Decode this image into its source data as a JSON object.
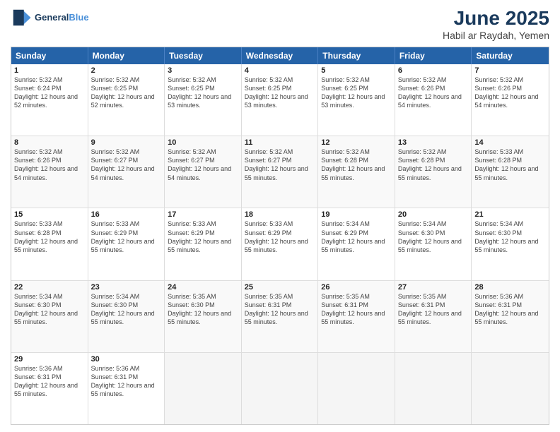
{
  "header": {
    "logo_line1": "General",
    "logo_line2": "Blue",
    "title": "June 2025",
    "subtitle": "Habil ar Raydah, Yemen"
  },
  "weekdays": [
    "Sunday",
    "Monday",
    "Tuesday",
    "Wednesday",
    "Thursday",
    "Friday",
    "Saturday"
  ],
  "weeks": [
    [
      {
        "day": "1",
        "sunrise": "5:32 AM",
        "sunset": "6:24 PM",
        "daylight": "12 hours and 52 minutes."
      },
      {
        "day": "2",
        "sunrise": "5:32 AM",
        "sunset": "6:25 PM",
        "daylight": "12 hours and 52 minutes."
      },
      {
        "day": "3",
        "sunrise": "5:32 AM",
        "sunset": "6:25 PM",
        "daylight": "12 hours and 53 minutes."
      },
      {
        "day": "4",
        "sunrise": "5:32 AM",
        "sunset": "6:25 PM",
        "daylight": "12 hours and 53 minutes."
      },
      {
        "day": "5",
        "sunrise": "5:32 AM",
        "sunset": "6:25 PM",
        "daylight": "12 hours and 53 minutes."
      },
      {
        "day": "6",
        "sunrise": "5:32 AM",
        "sunset": "6:26 PM",
        "daylight": "12 hours and 54 minutes."
      },
      {
        "day": "7",
        "sunrise": "5:32 AM",
        "sunset": "6:26 PM",
        "daylight": "12 hours and 54 minutes."
      }
    ],
    [
      {
        "day": "8",
        "sunrise": "5:32 AM",
        "sunset": "6:26 PM",
        "daylight": "12 hours and 54 minutes."
      },
      {
        "day": "9",
        "sunrise": "5:32 AM",
        "sunset": "6:27 PM",
        "daylight": "12 hours and 54 minutes."
      },
      {
        "day": "10",
        "sunrise": "5:32 AM",
        "sunset": "6:27 PM",
        "daylight": "12 hours and 54 minutes."
      },
      {
        "day": "11",
        "sunrise": "5:32 AM",
        "sunset": "6:27 PM",
        "daylight": "12 hours and 55 minutes."
      },
      {
        "day": "12",
        "sunrise": "5:32 AM",
        "sunset": "6:28 PM",
        "daylight": "12 hours and 55 minutes."
      },
      {
        "day": "13",
        "sunrise": "5:32 AM",
        "sunset": "6:28 PM",
        "daylight": "12 hours and 55 minutes."
      },
      {
        "day": "14",
        "sunrise": "5:33 AM",
        "sunset": "6:28 PM",
        "daylight": "12 hours and 55 minutes."
      }
    ],
    [
      {
        "day": "15",
        "sunrise": "5:33 AM",
        "sunset": "6:28 PM",
        "daylight": "12 hours and 55 minutes."
      },
      {
        "day": "16",
        "sunrise": "5:33 AM",
        "sunset": "6:29 PM",
        "daylight": "12 hours and 55 minutes."
      },
      {
        "day": "17",
        "sunrise": "5:33 AM",
        "sunset": "6:29 PM",
        "daylight": "12 hours and 55 minutes."
      },
      {
        "day": "18",
        "sunrise": "5:33 AM",
        "sunset": "6:29 PM",
        "daylight": "12 hours and 55 minutes."
      },
      {
        "day": "19",
        "sunrise": "5:34 AM",
        "sunset": "6:29 PM",
        "daylight": "12 hours and 55 minutes."
      },
      {
        "day": "20",
        "sunrise": "5:34 AM",
        "sunset": "6:30 PM",
        "daylight": "12 hours and 55 minutes."
      },
      {
        "day": "21",
        "sunrise": "5:34 AM",
        "sunset": "6:30 PM",
        "daylight": "12 hours and 55 minutes."
      }
    ],
    [
      {
        "day": "22",
        "sunrise": "5:34 AM",
        "sunset": "6:30 PM",
        "daylight": "12 hours and 55 minutes."
      },
      {
        "day": "23",
        "sunrise": "5:34 AM",
        "sunset": "6:30 PM",
        "daylight": "12 hours and 55 minutes."
      },
      {
        "day": "24",
        "sunrise": "5:35 AM",
        "sunset": "6:30 PM",
        "daylight": "12 hours and 55 minutes."
      },
      {
        "day": "25",
        "sunrise": "5:35 AM",
        "sunset": "6:31 PM",
        "daylight": "12 hours and 55 minutes."
      },
      {
        "day": "26",
        "sunrise": "5:35 AM",
        "sunset": "6:31 PM",
        "daylight": "12 hours and 55 minutes."
      },
      {
        "day": "27",
        "sunrise": "5:35 AM",
        "sunset": "6:31 PM",
        "daylight": "12 hours and 55 minutes."
      },
      {
        "day": "28",
        "sunrise": "5:36 AM",
        "sunset": "6:31 PM",
        "daylight": "12 hours and 55 minutes."
      }
    ],
    [
      {
        "day": "29",
        "sunrise": "5:36 AM",
        "sunset": "6:31 PM",
        "daylight": "12 hours and 55 minutes."
      },
      {
        "day": "30",
        "sunrise": "5:36 AM",
        "sunset": "6:31 PM",
        "daylight": "12 hours and 55 minutes."
      },
      null,
      null,
      null,
      null,
      null
    ]
  ]
}
